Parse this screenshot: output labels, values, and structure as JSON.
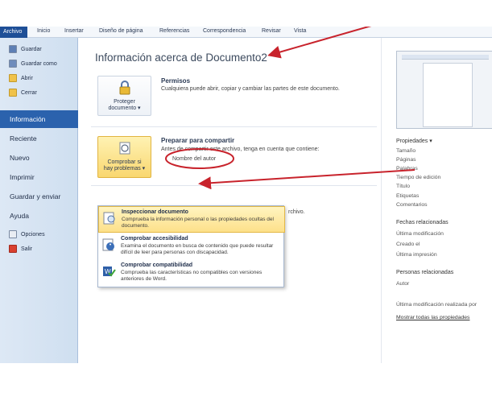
{
  "ribbon": {
    "tabs": [
      "Archivo",
      "Inicio",
      "Insertar",
      "Diseño de página",
      "Referencias",
      "Correspondencia",
      "Revisar",
      "Vista"
    ]
  },
  "nav": {
    "quick": [
      "Guardar",
      "Guardar como",
      "Abrir",
      "Cerrar"
    ],
    "items": [
      "Información",
      "Reciente",
      "Nuevo",
      "Imprimir",
      "Guardar y enviar",
      "Ayuda"
    ],
    "bottom": [
      "Opciones",
      "Salir"
    ]
  },
  "main": {
    "title": "Información acerca de Documento2",
    "permissions": {
      "button_line1": "Proteger",
      "button_line2": "documento ▾",
      "heading": "Permisos",
      "text": "Cualquiera puede abrir, copiar y cambiar las partes de este documento."
    },
    "prepare": {
      "button_line1": "Comprobar si",
      "button_line2": "hay problemas ▾",
      "heading": "Preparar para compartir",
      "text": "Antes de compartir este archivo, tenga en cuenta que contiene:",
      "item": "Nombre del autor"
    },
    "hidden_tail": "rchivo."
  },
  "menu": [
    {
      "title": "Inspeccionar documento",
      "desc": "Comprueba la información personal o las propiedades ocultas del documento."
    },
    {
      "title": "Comprobar accesibilidad",
      "desc": "Examina el documento en busca de contenido que puede resultar difícil de leer para personas con discapacidad."
    },
    {
      "title": "Comprobar compatibilidad",
      "desc": "Comprueba las características no compatibles con versiones anteriores de Word."
    }
  ],
  "properties": {
    "heading": "Propiedades ▾",
    "fields": [
      "Tamaño",
      "Páginas",
      "Palabras",
      "Tiempo de edición",
      "Título",
      "Etiquetas",
      "Comentarios"
    ],
    "dates_heading": "Fechas relacionadas",
    "dates": [
      "Última modificación",
      "Creado el",
      "Última impresión"
    ],
    "people_heading": "Personas relacionadas",
    "people": [
      "Autor"
    ],
    "last_modified_by": "Última modificación realizada por",
    "show_all": "Mostrar todas las propiedades"
  },
  "colors": {
    "accent": "#2b62ad",
    "highlight": "#fde08a",
    "annotation": "#c8232c"
  }
}
